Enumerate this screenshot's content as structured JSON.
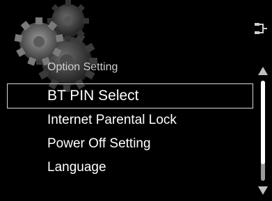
{
  "header": {
    "title": "Option Setting",
    "decoration_icon": "gears-icon",
    "corner_icon": "input-connection-icon"
  },
  "menu": {
    "items": [
      {
        "label": "BT PIN Select",
        "selected": true
      },
      {
        "label": "Internet Parental Lock",
        "selected": false
      },
      {
        "label": "Power Off Setting",
        "selected": false
      },
      {
        "label": "Language",
        "selected": false
      }
    ]
  },
  "scrollbar": {
    "position_fraction": 0.0,
    "visible_fraction": 0.83
  },
  "colors": {
    "background": "#000000",
    "text": "#ffffff",
    "title": "#cfcfcf",
    "selection_border": "#d9d9d9",
    "scroll_track": "#9a9a9a",
    "scroll_thumb": "#ffffff"
  }
}
